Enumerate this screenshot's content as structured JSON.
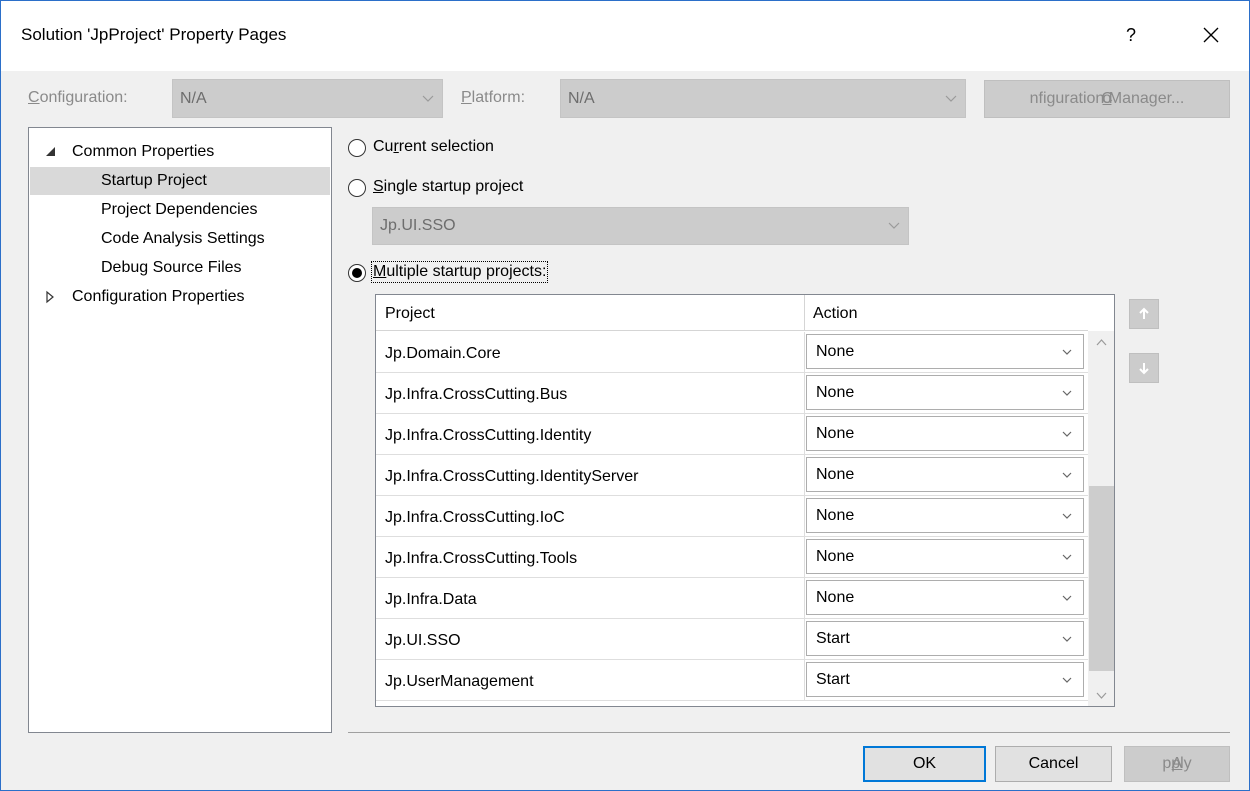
{
  "window": {
    "title": "Solution 'JpProject' Property Pages",
    "help_label": "?"
  },
  "toolbar": {
    "configuration_label_mn": "C",
    "configuration_label_rest": "onfiguration:",
    "configuration_value": "N/A",
    "platform_label_mn": "P",
    "platform_label_rest": "latform:",
    "platform_value": "N/A",
    "config_manager_mn": "o",
    "config_manager_pre": "C",
    "config_manager_rest": "nfiguration Manager..."
  },
  "tree": {
    "items": [
      {
        "label": "Common Properties",
        "expanded": true
      },
      {
        "label": "Startup Project",
        "selected": true
      },
      {
        "label": "Project Dependencies"
      },
      {
        "label": "Code Analysis Settings"
      },
      {
        "label": "Debug Source Files"
      },
      {
        "label": "Configuration Properties",
        "expanded": false
      }
    ]
  },
  "startup": {
    "current_pre": "Cu",
    "current_mn": "r",
    "current_rest": "rent selection",
    "single_mn": "S",
    "single_rest": "ingle startup project",
    "single_value": "Jp.UI.SSO",
    "multiple_mn": "M",
    "multiple_rest": "ultiple startup projects:",
    "selected_option": "multiple"
  },
  "grid": {
    "headers": [
      "Project",
      "Action"
    ],
    "rows": [
      {
        "project": "Jp.Domain.Core",
        "action": "None"
      },
      {
        "project": "Jp.Infra.CrossCutting.Bus",
        "action": "None"
      },
      {
        "project": "Jp.Infra.CrossCutting.Identity",
        "action": "None"
      },
      {
        "project": "Jp.Infra.CrossCutting.IdentityServer",
        "action": "None"
      },
      {
        "project": "Jp.Infra.CrossCutting.IoC",
        "action": "None"
      },
      {
        "project": "Jp.Infra.CrossCutting.Tools",
        "action": "None"
      },
      {
        "project": "Jp.Infra.Data",
        "action": "None"
      },
      {
        "project": "Jp.UI.SSO",
        "action": "Start"
      },
      {
        "project": "Jp.UserManagement",
        "action": "Start"
      }
    ]
  },
  "footer": {
    "ok_label": "OK",
    "cancel_label": "Cancel",
    "apply_mn": "A",
    "apply_rest": "pply"
  },
  "colors": {
    "accent": "#0078d7",
    "selection": "#d9d9d9",
    "disabled_fill": "#cccccc",
    "window_border": "#2b6fc9"
  }
}
